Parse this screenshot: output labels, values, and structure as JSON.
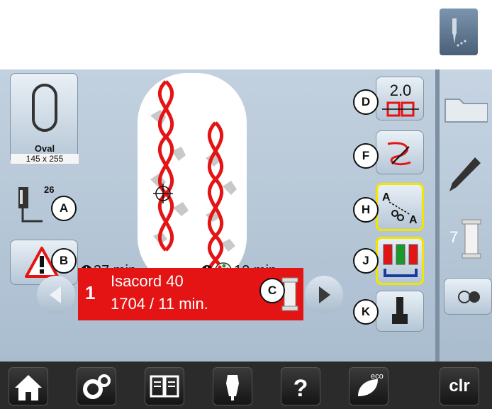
{
  "hoop": {
    "name": "Oval",
    "size": "145 x 255"
  },
  "foot": {
    "number": "26"
  },
  "times": {
    "total": "37 min.",
    "color": "12 min."
  },
  "thread": {
    "index": "1",
    "brand": "Isacord 40",
    "code_time": "1704 / 11 min."
  },
  "buttons": {
    "scale": {
      "value": "2.0"
    },
    "spool_count": "7",
    "clr_label": "clr",
    "eco_label": "eco"
  },
  "markers": {
    "A": "A",
    "B": "B",
    "C": "C",
    "D": "D",
    "F": "F",
    "H": "H",
    "J": "J",
    "K": "K"
  },
  "colors": {
    "accent_red": "#e41414",
    "highlight": "#f2e600",
    "panel_blue": "#b8c8d8"
  },
  "icons": [
    "stitch-mode-icon",
    "hoop-icon",
    "presser-foot-icon",
    "warning-icon",
    "clock-icon",
    "color-clock-icon",
    "thread-spool-icon",
    "prev-arrow-icon",
    "next-arrow-icon",
    "frame-icon",
    "thread-cut-icon",
    "thread-color-change-icon",
    "embroidery-start-icon",
    "folder-icon",
    "pencil-icon",
    "spool-icon",
    "toggle-icon",
    "home-icon",
    "settings-icon",
    "tutorial-icon",
    "dress-form-icon",
    "help-icon",
    "eco-icon"
  ]
}
